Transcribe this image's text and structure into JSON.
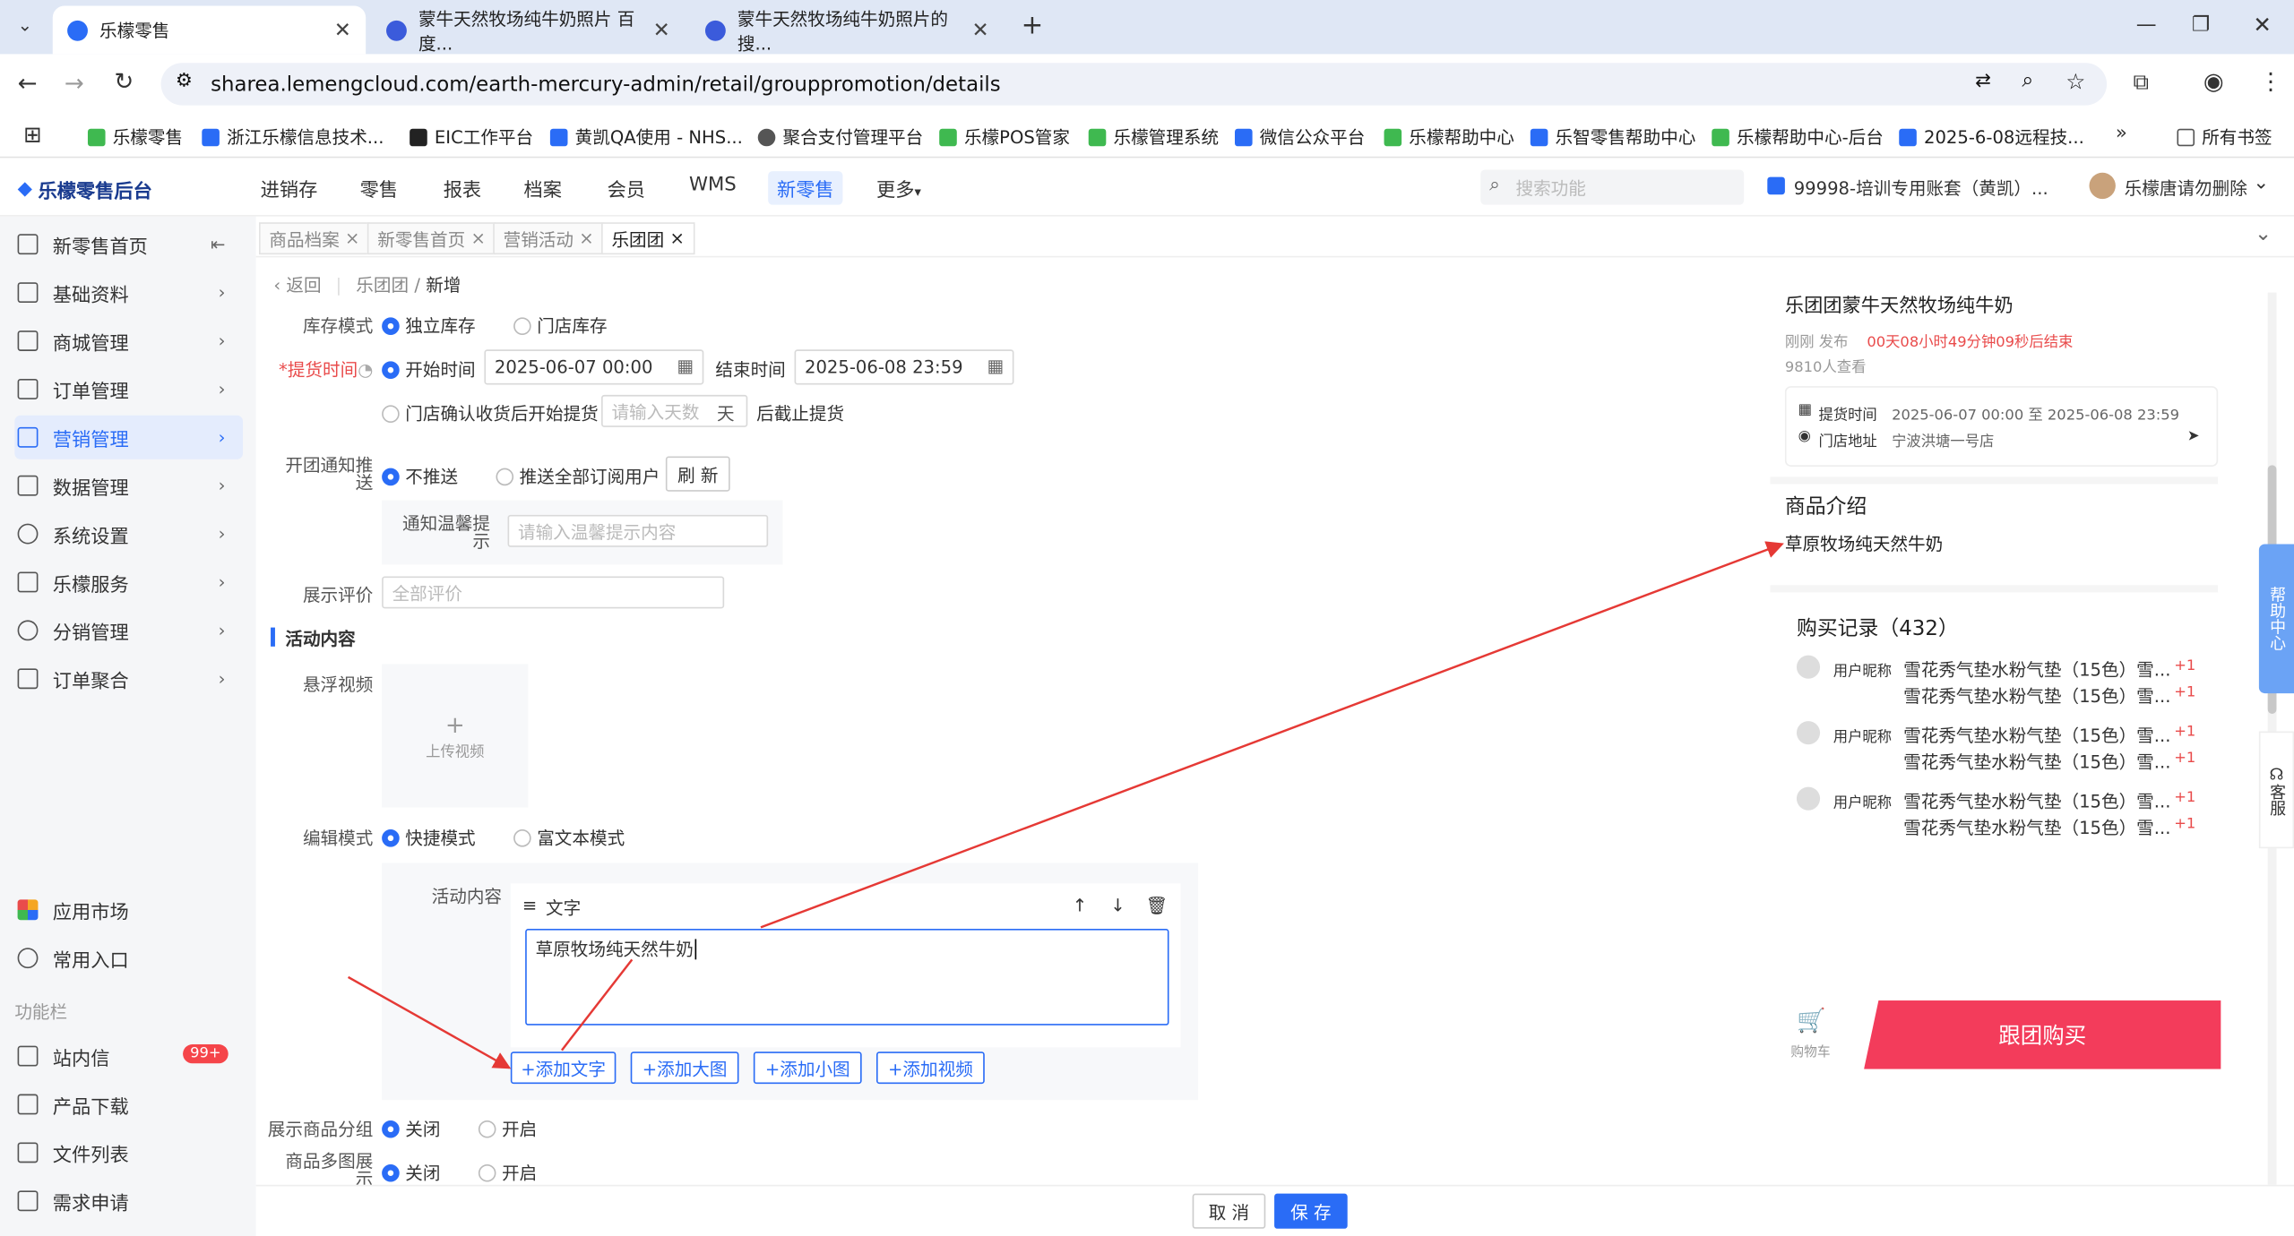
{
  "browser": {
    "tabs": [
      {
        "title": "乐檬零售"
      },
      {
        "title": "蒙牛天然牧场纯牛奶照片 百度..."
      },
      {
        "title": "蒙牛天然牧场纯牛奶照片的搜..."
      }
    ],
    "url": "sharea.lemengcloud.com/earth-mercury-admin/retail/grouppromotion/details",
    "bookmarks": [
      "乐檬零售",
      "浙江乐檬信息技术...",
      "EIC工作平台",
      "黄凯QA使用 - NHS...",
      "聚合支付管理平台",
      "乐檬POS管家",
      "乐檬管理系统",
      "微信公众平台",
      "乐檬帮助中心",
      "乐智零售帮助中心",
      "乐檬帮助中心-后台",
      "2025-6-08远程技..."
    ],
    "all_bookmarks": "所有书签"
  },
  "app": {
    "logo": "乐檬零售后台",
    "nav": [
      "进销存",
      "零售",
      "报表",
      "档案",
      "会员",
      "WMS",
      "新零售",
      "更多"
    ],
    "search_placeholder": "搜索功能",
    "account": "99998-培训专用账套（黄凯）...",
    "user": "乐檬唐请勿删除"
  },
  "sidebar": {
    "items": [
      "新零售首页",
      "基础资料",
      "商城管理",
      "订单管理",
      "营销管理",
      "数据管理",
      "系统设置",
      "乐檬服务",
      "分销管理",
      "订单聚合"
    ],
    "extra": [
      "应用市场",
      "常用入口"
    ],
    "section": "功能栏",
    "tools": [
      "站内信",
      "产品下载",
      "文件列表",
      "需求申请"
    ],
    "badge": "99+"
  },
  "pagetabs": [
    "商品档案",
    "新零售首页",
    "营销活动",
    "乐团团"
  ],
  "breadcrumb": {
    "back": "返回",
    "parent": "乐团团",
    "current": "新增"
  },
  "form": {
    "stock_mode_label": "库存模式",
    "stock_opt1": "独立库存",
    "stock_opt2": "门店库存",
    "pickup_label": "*提货时间",
    "start_label": "开始时间",
    "start_value": "2025-06-07 00:00",
    "end_label": "结束时间",
    "end_value": "2025-06-08 23:59",
    "store_confirm": "门店确认收货后开始提货",
    "days_placeholder": "请输入天数",
    "days_unit": "天",
    "after_stop": "后截止提货",
    "notify_label": "开团通知推送",
    "notify_opt1": "不推送",
    "notify_opt2": "推送全部订阅用户",
    "refresh": "刷 新",
    "tip_label": "通知温馨提示",
    "tip_placeholder": "请输入温馨提示内容",
    "review_label": "展示评价",
    "review_placeholder": "全部评价",
    "section_title": "活动内容",
    "float_video_label": "悬浮视频",
    "upload_video": "上传视频",
    "edit_mode_label": "编辑模式",
    "edit_opt1": "快捷模式",
    "edit_opt2": "富文本模式",
    "content_label": "活动内容",
    "block_type": "文字",
    "text_value": "草原牧场纯天然牛奶",
    "add_text": "+添加文字",
    "add_big": "+添加大图",
    "add_small": "+添加小图",
    "add_video": "+添加视频",
    "group_label": "展示商品分组",
    "multi_label": "商品多图展示",
    "off": "关闭",
    "on": "开启",
    "cancel": "取 消",
    "save": "保 存"
  },
  "preview": {
    "title": "乐团团蒙牛天然牧场纯牛奶",
    "published": "刚刚 发布",
    "countdown": "00天08小时49分钟09秒后结束",
    "views": "9810人查看",
    "pickup_time_label": "提货时间",
    "pickup_time": "2025-06-07 00:00 至 2025-06-08 23:59",
    "store_label": "门店地址",
    "store": "宁波洪塘一号店",
    "intro_title": "商品介绍",
    "intro_text": "草原牧场纯天然牛奶",
    "records_title": "购买记录（432）",
    "nickname": "用户昵称",
    "record_item": "雪花秀气垫水粉气垫（15色）雪...",
    "plus": "+1",
    "cart": "购物车",
    "buy": "跟团购买"
  },
  "helpers": {
    "help": "帮助中心",
    "service": "客服"
  }
}
